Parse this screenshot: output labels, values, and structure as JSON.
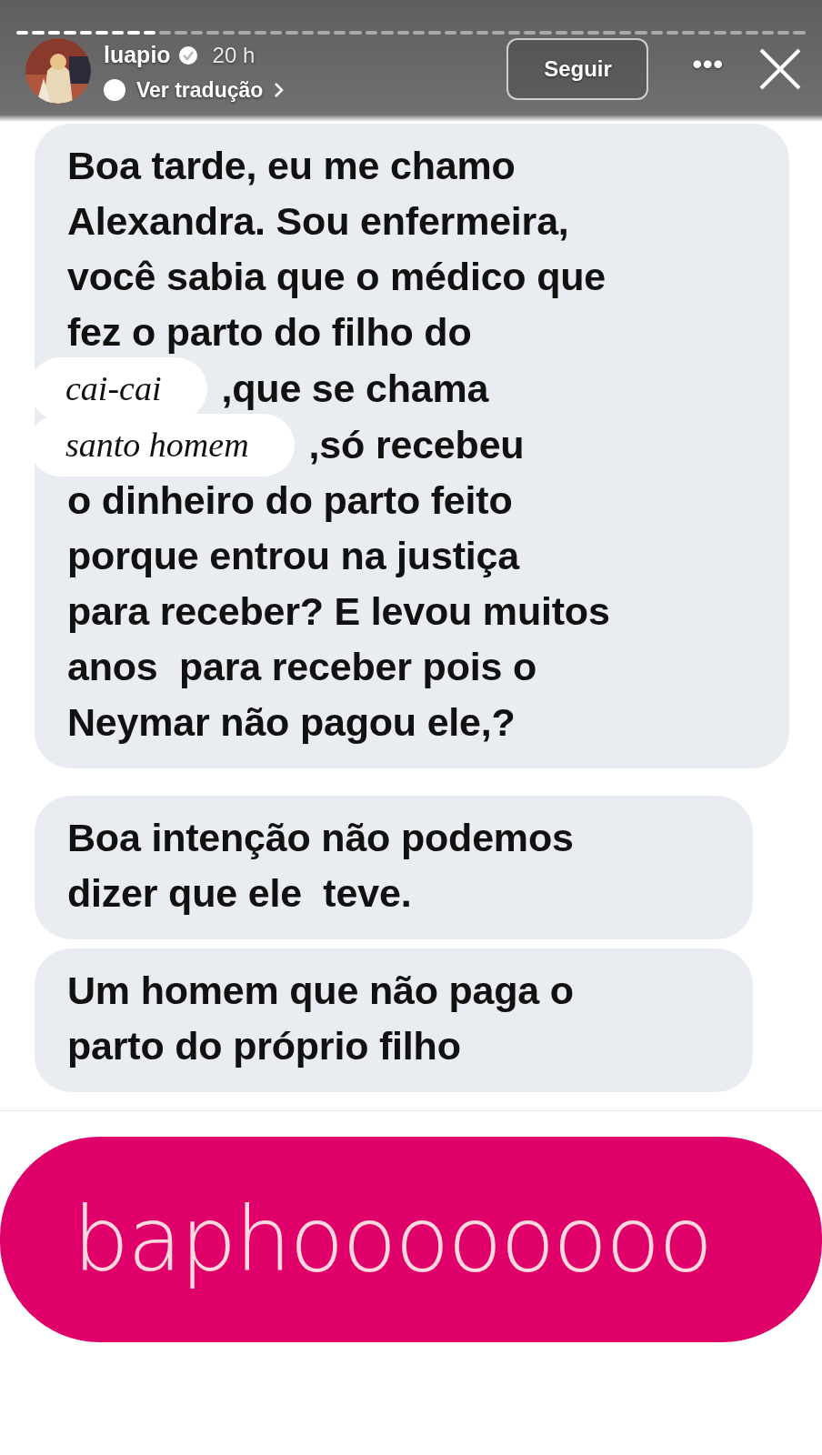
{
  "progress": [
    {
      "seen": true
    },
    {
      "seen": true
    },
    {
      "seen": true
    },
    {
      "seen": true
    },
    {
      "seen": true
    },
    {
      "seen": true
    },
    {
      "seen": true
    },
    {
      "seen": true
    },
    {
      "seen": true
    },
    {
      "seen": false
    },
    {
      "seen": false
    },
    {
      "seen": false
    },
    {
      "seen": false
    },
    {
      "seen": false
    },
    {
      "seen": false
    },
    {
      "seen": false
    },
    {
      "seen": false
    },
    {
      "seen": false
    },
    {
      "seen": false
    },
    {
      "seen": false
    },
    {
      "seen": false
    },
    {
      "seen": false
    },
    {
      "seen": false
    },
    {
      "seen": false
    },
    {
      "seen": false
    },
    {
      "seen": false
    },
    {
      "seen": false
    },
    {
      "seen": false
    },
    {
      "seen": false
    },
    {
      "seen": false
    },
    {
      "seen": false
    },
    {
      "seen": false
    },
    {
      "seen": false
    },
    {
      "seen": false
    },
    {
      "seen": false
    },
    {
      "seen": false
    },
    {
      "seen": false
    },
    {
      "seen": false
    },
    {
      "seen": false
    },
    {
      "seen": false
    },
    {
      "seen": false
    },
    {
      "seen": false
    },
    {
      "seen": false
    },
    {
      "seen": false
    },
    {
      "seen": false
    },
    {
      "seen": false
    },
    {
      "seen": false
    },
    {
      "seen": false
    },
    {
      "seen": false
    },
    {
      "seen": false
    }
  ],
  "header": {
    "username": "luapio",
    "verified": true,
    "time": "20 h",
    "translate": "Ver tradução",
    "follow": "Seguir",
    "more": "•••"
  },
  "messages": [
    {
      "parts": [
        {
          "kind": "line",
          "text": "Boa tarde, eu me chamo"
        },
        {
          "kind": "line",
          "text": "Alexandra. Sou enfermeira,"
        },
        {
          "kind": "line",
          "text": "você sabia que o médico que"
        },
        {
          "kind": "line",
          "text": "fez o parto do filho do"
        },
        {
          "kind": "sticker",
          "sticker": "cai-cai",
          "text": ",que se chama"
        },
        {
          "kind": "sticker",
          "sticker": "santo homem",
          "text": ",só recebeu"
        },
        {
          "kind": "line",
          "text": "o dinheiro do parto feito"
        },
        {
          "kind": "line",
          "text": "porque entrou na justiça"
        },
        {
          "kind": "line",
          "text": "para receber? E levou muitos"
        },
        {
          "kind": "line",
          "text": "anos  para receber pois o"
        },
        {
          "kind": "line",
          "text": "Neymar não pagou ele,?"
        }
      ]
    },
    {
      "parts": [
        {
          "kind": "line",
          "text": "Boa intenção não podemos"
        },
        {
          "kind": "line",
          "text": "dizer que ele  teve."
        }
      ]
    },
    {
      "parts": [
        {
          "kind": "line",
          "text": "Um homem que não paga o"
        },
        {
          "kind": "line",
          "text": "parto do próprio filho"
        }
      ]
    }
  ],
  "caption": "baphoooooooo"
}
